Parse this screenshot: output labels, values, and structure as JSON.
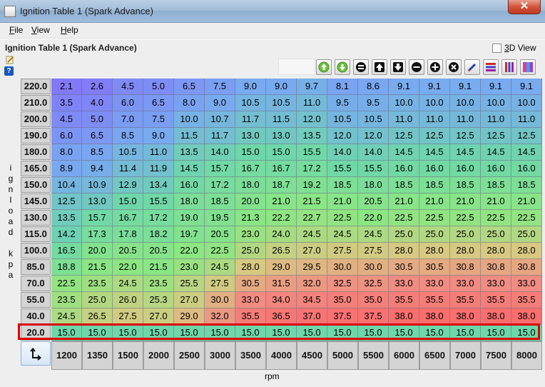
{
  "window": {
    "title": "Ignition Table 1 (Spark Advance)",
    "close_label": "✕"
  },
  "menu": [
    {
      "label": "File",
      "u": "F",
      "rest": "ile"
    },
    {
      "label": "View",
      "u": "V",
      "rest": "iew"
    },
    {
      "label": "Help",
      "u": "H",
      "rest": "elp"
    }
  ],
  "panel": {
    "table_title": "Ignition Table 1 (Spark Advance)",
    "view3d_label": "3D View",
    "view3d_checked": false,
    "help_icon": "?"
  },
  "toolbar_icons": [
    "up-green-icon",
    "down-green-icon",
    "equals-icon",
    "shift-up-icon",
    "shift-down-icon",
    "minus-icon",
    "plus-icon",
    "clear-icon",
    "pencil-icon",
    "color-rows-icon",
    "color-cols-icon",
    "color-gradient-icon"
  ],
  "y_axis": {
    "label_letters": [
      "i",
      "g",
      "n",
      "l",
      "o",
      "a",
      "d",
      "",
      "k",
      "p",
      "a"
    ]
  },
  "x_axis": {
    "label": "rpm"
  },
  "table": {
    "row_labels": [
      "220.0",
      "210.0",
      "200.0",
      "190.0",
      "180.0",
      "165.0",
      "150.0",
      "145.0",
      "130.0",
      "115.0",
      "100.0",
      "85.0",
      "70.0",
      "55.0",
      "40.0",
      "20.0"
    ],
    "col_labels": [
      "1200",
      "1350",
      "1500",
      "2000",
      "2500",
      "3000",
      "3500",
      "4000",
      "4500",
      "5000",
      "5500",
      "6000",
      "6500",
      "7000",
      "7500",
      "8000"
    ],
    "rows": [
      [
        "2.1",
        "2.6",
        "4.5",
        "5.0",
        "6.5",
        "7.5",
        "9.0",
        "9.0",
        "9.7",
        "8.1",
        "8.6",
        "9.1",
        "9.1",
        "9.1",
        "9.1",
        "9.1"
      ],
      [
        "3.5",
        "4.0",
        "6.0",
        "6.5",
        "8.0",
        "9.0",
        "10.5",
        "10.5",
        "11.0",
        "9.5",
        "9.5",
        "10.0",
        "10.0",
        "10.0",
        "10.0",
        "10.0"
      ],
      [
        "4.5",
        "5.0",
        "7.0",
        "7.5",
        "10.0",
        "10.7",
        "11.7",
        "11.5",
        "12.0",
        "10.5",
        "10.5",
        "11.0",
        "11.0",
        "11.0",
        "11.0",
        "11.0"
      ],
      [
        "6.0",
        "6.5",
        "8.5",
        "9.0",
        "11.5",
        "11.7",
        "13.0",
        "13.0",
        "13.5",
        "12.0",
        "12.0",
        "12.5",
        "12.5",
        "12.5",
        "12.5",
        "12.5"
      ],
      [
        "8.0",
        "8.5",
        "10.5",
        "11.0",
        "13.5",
        "14.0",
        "15.0",
        "15.0",
        "15.5",
        "14.0",
        "14.0",
        "14.5",
        "14.5",
        "14.5",
        "14.5",
        "14.5"
      ],
      [
        "8.9",
        "9.4",
        "11.4",
        "11.9",
        "14.5",
        "15.7",
        "16.7",
        "16.7",
        "17.2",
        "15.5",
        "15.5",
        "16.0",
        "16.0",
        "16.0",
        "16.0",
        "16.0"
      ],
      [
        "10.4",
        "10.9",
        "12.9",
        "13.4",
        "16.0",
        "17.2",
        "18.0",
        "18.7",
        "19.2",
        "18.5",
        "18.0",
        "18.5",
        "18.5",
        "18.5",
        "18.5",
        "18.5"
      ],
      [
        "12.5",
        "13.0",
        "15.0",
        "15.5",
        "18.0",
        "18.5",
        "20.0",
        "21.0",
        "21.5",
        "21.0",
        "20.5",
        "21.0",
        "21.0",
        "21.0",
        "21.0",
        "21.0"
      ],
      [
        "13.5",
        "15.7",
        "16.7",
        "17.2",
        "19.0",
        "19.5",
        "21.3",
        "22.2",
        "22.7",
        "22.5",
        "22.0",
        "22.5",
        "22.5",
        "22.5",
        "22.5",
        "22.5"
      ],
      [
        "14.2",
        "17.3",
        "17.8",
        "18.2",
        "19.7",
        "20.5",
        "23.0",
        "24.0",
        "24.5",
        "24.5",
        "24.5",
        "25.0",
        "25.0",
        "25.0",
        "25.0",
        "25.0"
      ],
      [
        "16.5",
        "20.0",
        "20.5",
        "20.5",
        "22.0",
        "22.5",
        "25.0",
        "26.5",
        "27.0",
        "27.5",
        "27.5",
        "28.0",
        "28.0",
        "28.0",
        "28.0",
        "28.0"
      ],
      [
        "18.8",
        "21.5",
        "22.0",
        "21.5",
        "23.0",
        "24.5",
        "28.0",
        "29.0",
        "29.5",
        "30.0",
        "30.0",
        "30.5",
        "30.5",
        "30.8",
        "30.8",
        "30.8"
      ],
      [
        "22.5",
        "23.5",
        "24.5",
        "23.5",
        "25.5",
        "27.5",
        "30.5",
        "31.5",
        "32.0",
        "32.5",
        "32.5",
        "33.0",
        "33.0",
        "33.0",
        "33.0",
        "33.0"
      ],
      [
        "23.5",
        "25.0",
        "26.0",
        "25.3",
        "27.0",
        "30.0",
        "33.0",
        "34.0",
        "34.5",
        "35.0",
        "35.0",
        "35.5",
        "35.5",
        "35.5",
        "35.5",
        "35.5"
      ],
      [
        "24.5",
        "26.5",
        "27.5",
        "27.0",
        "29.0",
        "32.0",
        "35.5",
        "36.5",
        "37.0",
        "37.5",
        "37.5",
        "38.0",
        "38.0",
        "38.0",
        "38.0",
        "38.0"
      ],
      [
        "15.0",
        "15.0",
        "15.0",
        "15.0",
        "15.0",
        "15.0",
        "15.0",
        "15.0",
        "15.0",
        "15.0",
        "15.0",
        "15.0",
        "15.0",
        "15.0",
        "15.0",
        "15.0"
      ]
    ],
    "highlighted_row": "20.0",
    "highlight_color": "#dd0000"
  }
}
